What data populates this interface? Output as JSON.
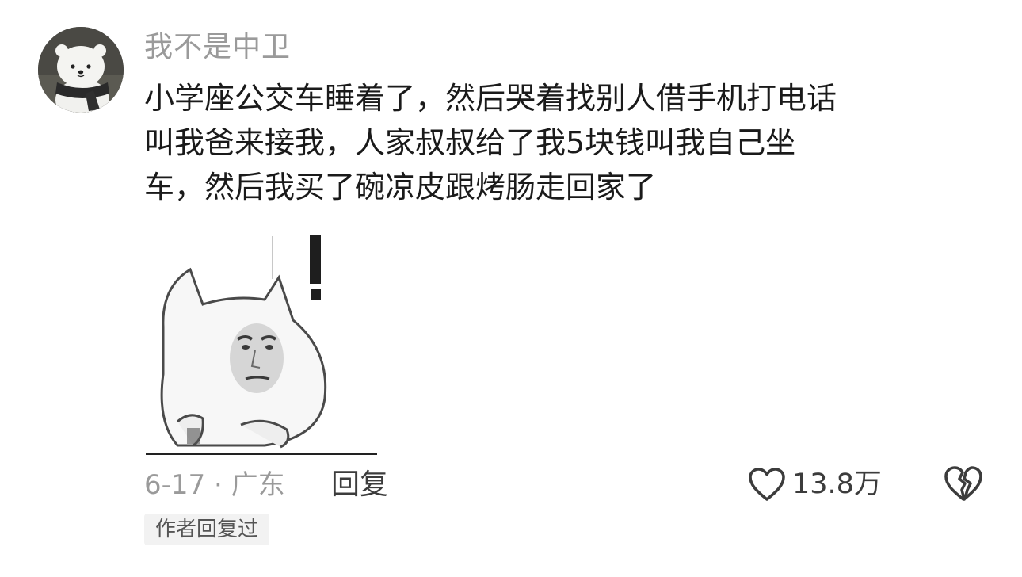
{
  "comment": {
    "username": "我不是中卫",
    "text_lines": [
      "小学座公交车睡着了，然后哭着找别人借手机打电话",
      "叫我爸来接我，人家叔叔给了我5块钱叫我自己坐",
      "车，然后我买了碗凉皮跟烤肠走回家了"
    ],
    "meta": "6-17 · 广东",
    "reply_label": "回复",
    "likes": "13.8万",
    "author_badge": "作者回复过"
  },
  "icons": {
    "avatar": "bear-avatar",
    "sticker": "cat-meme-sticker",
    "like": "heart-icon",
    "dislike": "broken-heart-icon"
  },
  "colors": {
    "username": "#9a9a9a",
    "text": "#1a1a1a",
    "meta": "#9a9a9a",
    "action": "#3c3c3c",
    "badge_bg": "#f2f2f2"
  }
}
